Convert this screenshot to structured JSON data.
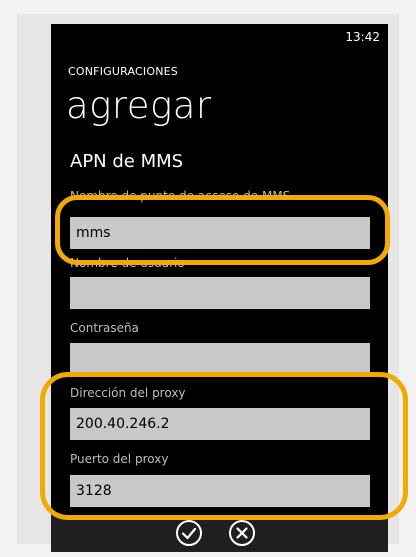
{
  "status_bar": {
    "time": "13:42"
  },
  "header": {
    "app_title": "CONFIGURACIONES",
    "page_title": "agregar"
  },
  "section": {
    "title": "APN de MMS"
  },
  "fields": {
    "apn_name": {
      "label": "Nombre de punto de acceso de MMS",
      "value": "mms"
    },
    "username": {
      "label": "Nombre de usuario",
      "value": ""
    },
    "password": {
      "label": "Contraseña",
      "value": ""
    },
    "proxy_address": {
      "label": "Dirección del proxy",
      "value": "200.40.246.2"
    },
    "proxy_port": {
      "label": "Puerto del proxy",
      "value": "3128"
    }
  },
  "app_bar": {
    "buttons": [
      {
        "name": "check-icon"
      },
      {
        "name": "cancel-icon"
      }
    ]
  },
  "highlight_color": "#f2a900"
}
